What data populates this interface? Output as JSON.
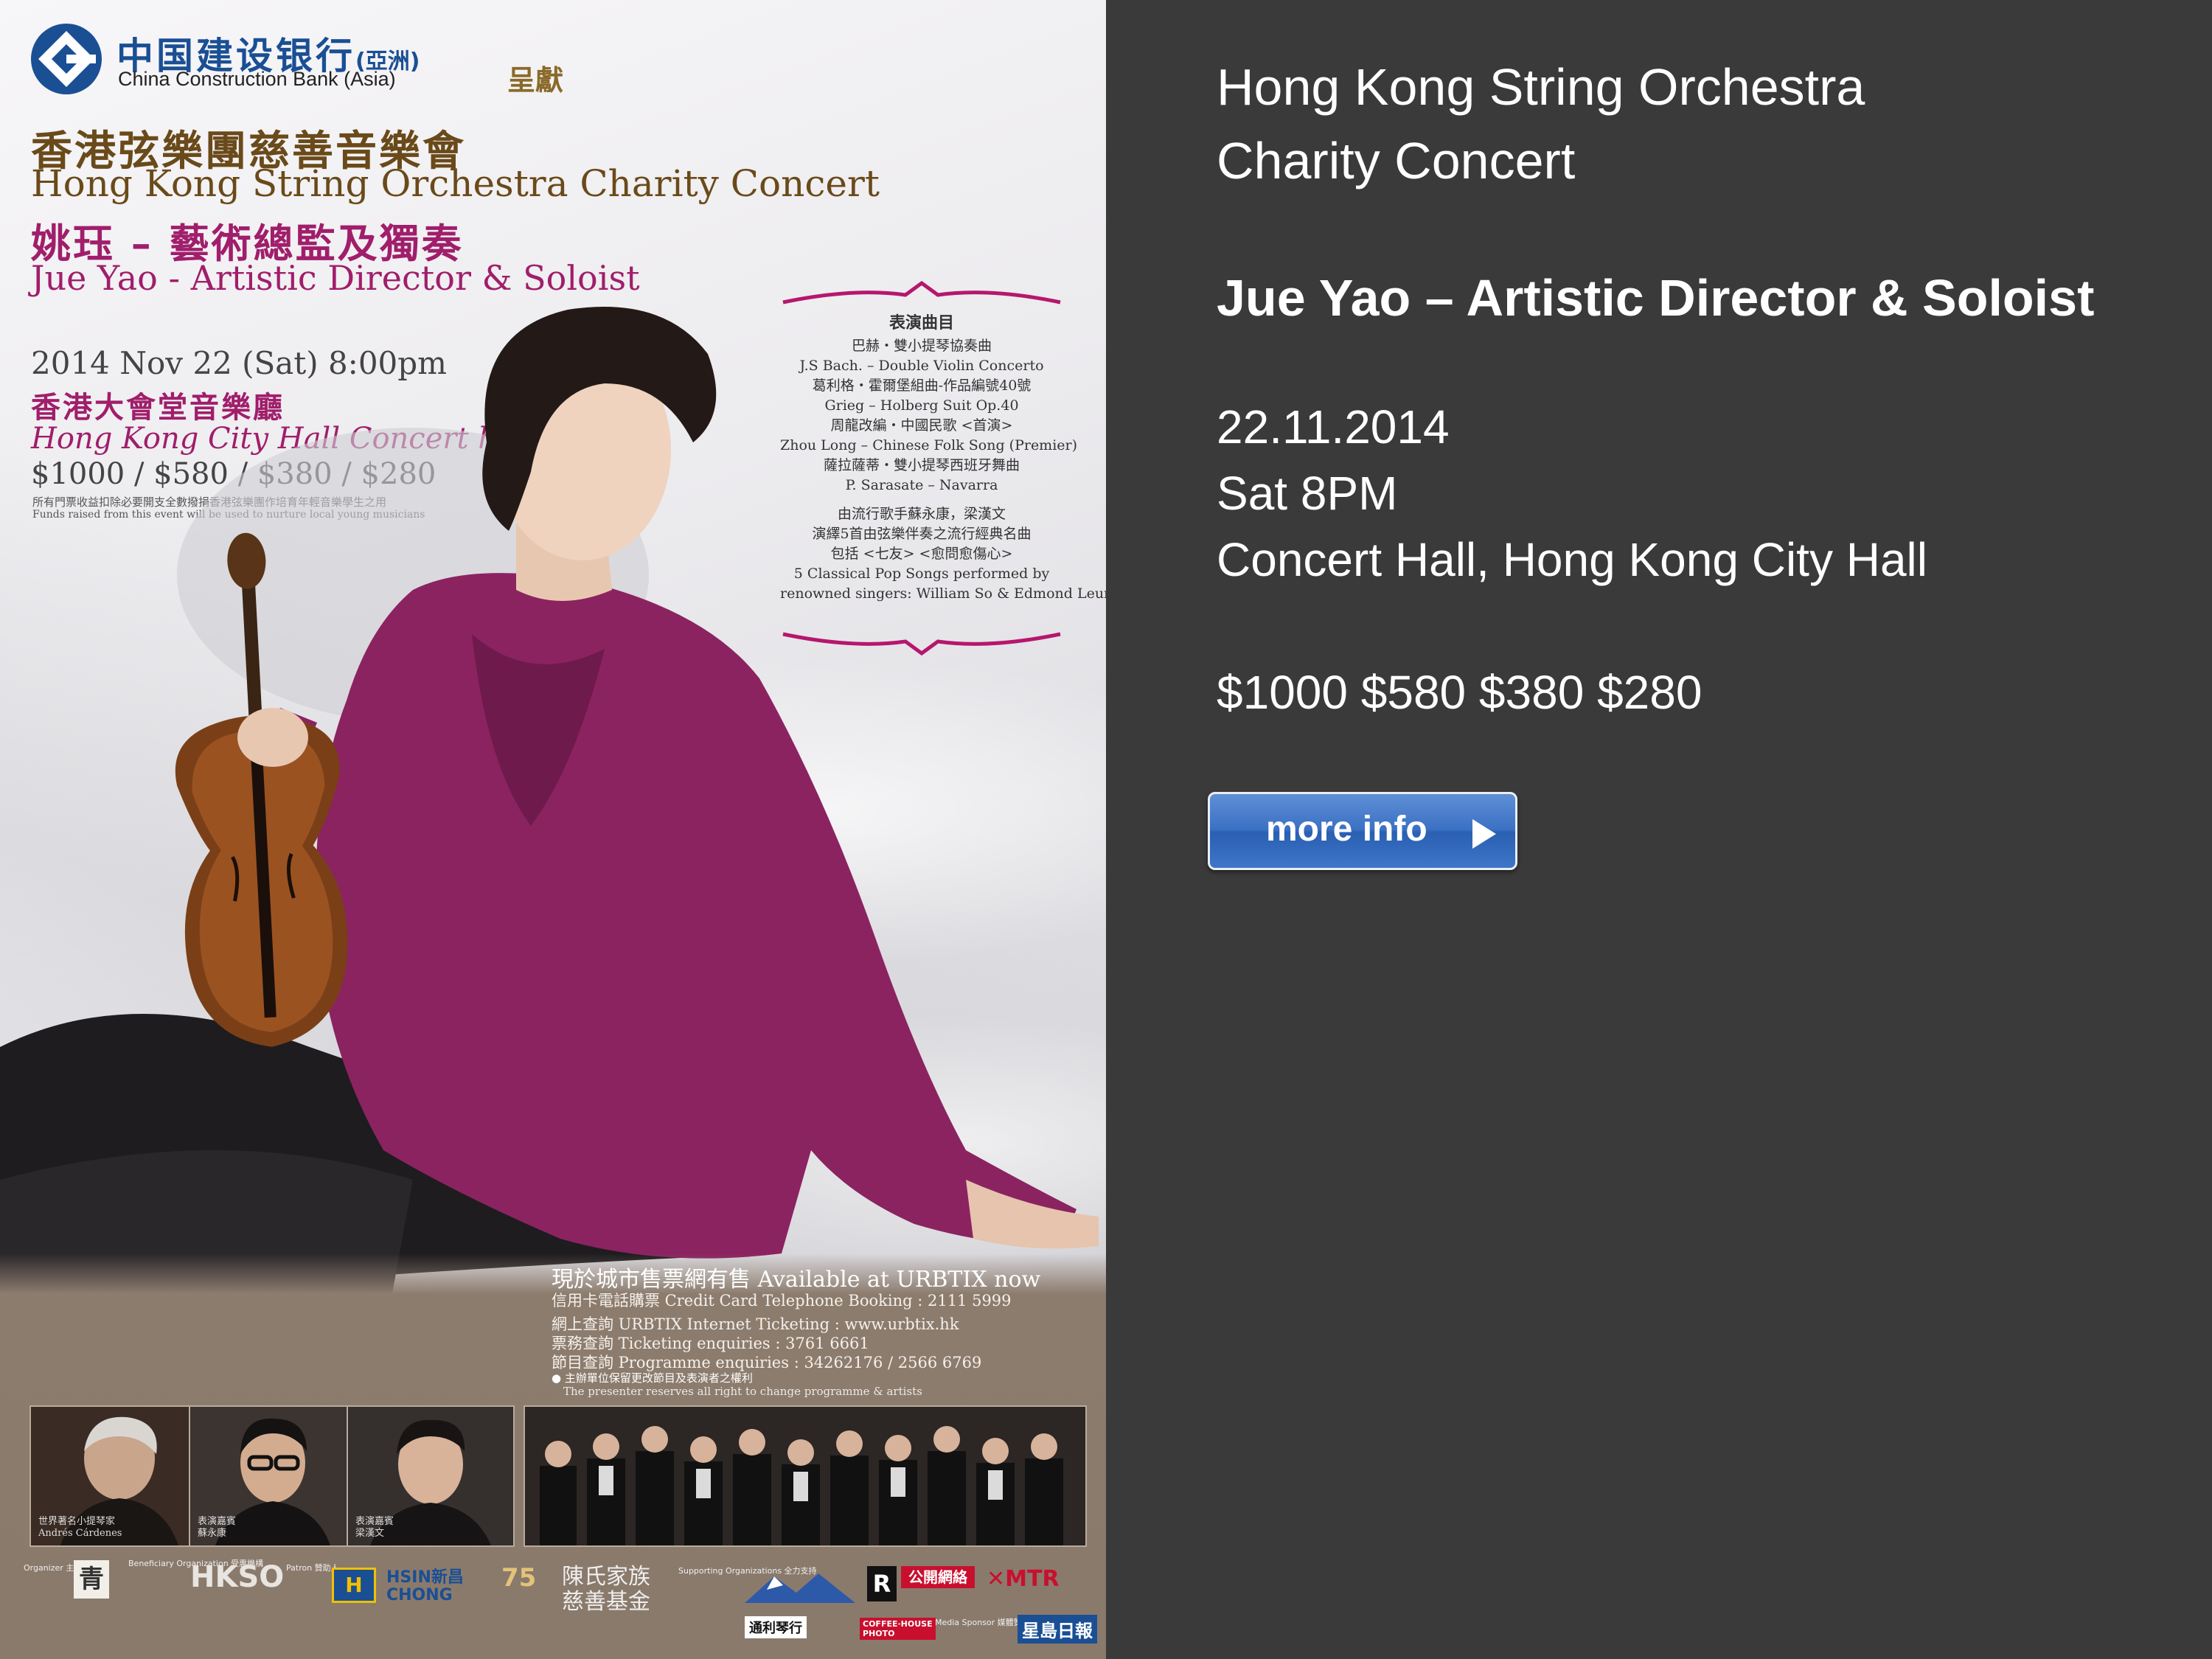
{
  "poster": {
    "bank_cn": "中国建设银行",
    "bank_cn_suffix": "(亞洲)",
    "bank_en": "China Construction Bank (Asia)",
    "presents": "呈獻",
    "title_cn": "香港弦樂團慈善音樂會",
    "title_en": "Hong Kong String Orchestra Charity Concert",
    "director_cn": "姚珏 – 藝術總監及獨奏",
    "director_en": "Jue Yao - Artistic Director & Soloist",
    "date": "2014 Nov 22 (Sat)  8:00pm",
    "venue_cn": "香港大會堂音樂廳",
    "venue_en": "Hong Kong City Hall Concert hall",
    "prices": "$1000 / $580 / $380 / $280",
    "funds_cn": "所有門票收益扣除必要開支全數撥捐香港弦樂團作培育年輕音樂學生之用",
    "funds_en": "Funds raised from this event will be used to nurture local young musicians",
    "programme": {
      "heading": "表演曲目",
      "lines": [
        "巴赫・雙小提琴協奏曲",
        "J.S Bach. – Double Violin Concerto",
        "葛利格・霍爾堡組曲-作品編號40號",
        "Grieg – Holberg Suit Op.40",
        "周龍改編・中國民歌 <首演>",
        "Zhou Long – Chinese Folk Song (Premier)",
        "薩拉薩蒂・雙小提琴西班牙舞曲",
        "P. Sarasate – Navarra"
      ],
      "pop_lines": [
        "由流行歌手蘇永康，梁漢文",
        "演繹5首由弦樂伴奏之流行經典名曲",
        "包括 <七友> <愈問愈傷心>",
        "5 Classical Pop Songs performed by",
        "renowned singers: William So & Edmond Leung"
      ]
    },
    "tickets": {
      "headline": "現於城市售票網有售 Available at URBTIX now",
      "line1": "信用卡電話購票 Credit Card Telephone Booking : 2111 5999",
      "line2": "網上查詢 URBTIX Internet Ticketing : www.urbtix.hk",
      "line3": "票務查詢 Ticketing enquiries : 3761 6661",
      "line4": "節目查詢 Programme enquiries : 34262176 / 2566 6769",
      "note_cn": "● 主辦單位保留更改節目及表演者之權利",
      "note_en": "The presenter reserves all right to change programme & artists"
    },
    "portraits": [
      {
        "caption_cn": "世界著名小提琴家",
        "caption_en": "Andrés Cárdenes"
      },
      {
        "caption_cn": "表演嘉賓",
        "caption_en": "蘇永康"
      },
      {
        "caption_cn": "表演嘉賓",
        "caption_en": "梁漢文"
      }
    ],
    "sponsors": {
      "organizer_label": "Organizer\n主辦機構",
      "beneficiary_label": "Beneficiary\nOrganization\n受惠機構",
      "hkso": "HKSO",
      "patron_label": "Patron\n贊助人",
      "hsin_chong": "HSIN新昌\nCHONG",
      "anniv": "75",
      "chan_family": "陳氏家族\n慈善基金",
      "supporting_label": "Supporting\nOrganizations\n全力支持",
      "tom_lee": "通利琴行",
      "coffee": "COFFEE·HOUSE\nPHOTO",
      "media_label": "Media Sponsor\n媒體贊助",
      "mtr": "MTR",
      "sing_tao": "星島日報"
    }
  },
  "event": {
    "title_line1": "Hong Kong String Orchestra",
    "title_line2": "Charity Concert",
    "director": "Jue Yao – Artistic Director & Soloist",
    "date": "22.11.2014",
    "time": "Sat 8PM",
    "venue": "Concert Hall, Hong Kong City Hall",
    "prices": "$1000 $580 $380 $280",
    "more_info_label": "more info",
    "more_info_icon": "play-arrow-icon"
  },
  "colors": {
    "panel_bg": "#3a3a3a",
    "button_blue": "#3b71c4",
    "poster_magenta": "#a01e6b",
    "bank_blue": "#1a4f94",
    "poster_gold": "#6a4a1a"
  }
}
